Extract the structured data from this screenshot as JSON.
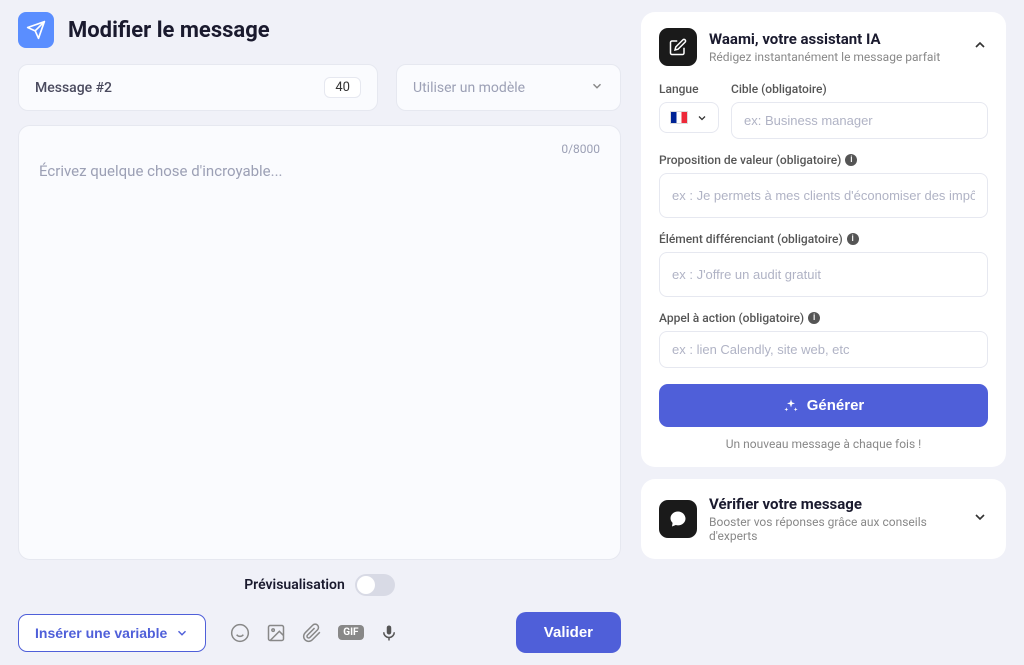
{
  "header": {
    "title": "Modifier le message"
  },
  "messageBox": {
    "label": "Message #2",
    "count": "40"
  },
  "templateSelect": {
    "placeholder": "Utiliser un modèle"
  },
  "editor": {
    "placeholder": "Écrivez quelque chose d'incroyable...",
    "counter": "0/8000"
  },
  "preview": {
    "label": "Prévisualisation"
  },
  "insertVariable": {
    "label": "Insérer une variable"
  },
  "toolbar": {
    "gif": "GIF"
  },
  "validate": {
    "label": "Valider"
  },
  "assistant": {
    "title": "Waami, votre assistant IA",
    "subtitle": "Rédigez instantanément le message parfait",
    "langLabel": "Langue",
    "targetLabel": "Cible (obligatoire)",
    "targetPlaceholder": "ex: Business manager",
    "valuePropLabel": "Proposition de valeur (obligatoire)",
    "valuePropPlaceholder": "ex : Je permets à mes clients d'économiser des impôts",
    "diffLabel": "Élément différenciant (obligatoire)",
    "diffPlaceholder": "ex : J'offre un audit gratuit",
    "ctaLabel": "Appel à action (obligatoire)",
    "ctaPlaceholder": "ex : lien Calendly, site web, etc",
    "generateLabel": "Générer",
    "generateNote": "Un nouveau message à chaque fois !"
  },
  "verify": {
    "title": "Vérifier votre message",
    "subtitle": "Booster vos réponses grâce aux conseils d'experts"
  }
}
